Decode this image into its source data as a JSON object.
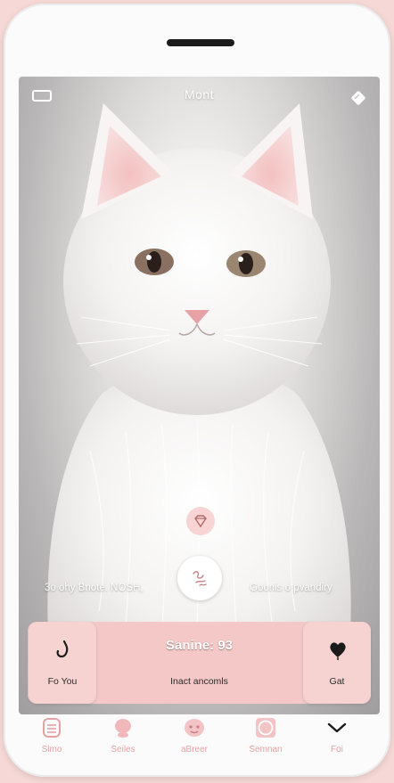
{
  "header": {
    "title": "Mont"
  },
  "overlay": {
    "caption_left": "3o ohy Bnote. NOSH,",
    "caption_right": "Goonis o pvandiry"
  },
  "card": {
    "title": "Sanine: 93",
    "subtitle": "Inact ancomls",
    "left_tile_label": "Fo You",
    "right_tile_label": "Gat"
  },
  "tabs": [
    {
      "label": "Slmo",
      "icon": "list-icon"
    },
    {
      "label": "Seiles",
      "icon": "cat-icon"
    },
    {
      "label": "aBreer",
      "icon": "face-icon"
    },
    {
      "label": "Semnan",
      "icon": "circle-square-icon"
    },
    {
      "label": "Foi",
      "icon": "chevron-down-icon"
    }
  ],
  "colors": {
    "accent_pink": "#f3c8c6",
    "tab_pink": "#e3a3a5",
    "background": "#f6d9d7"
  }
}
